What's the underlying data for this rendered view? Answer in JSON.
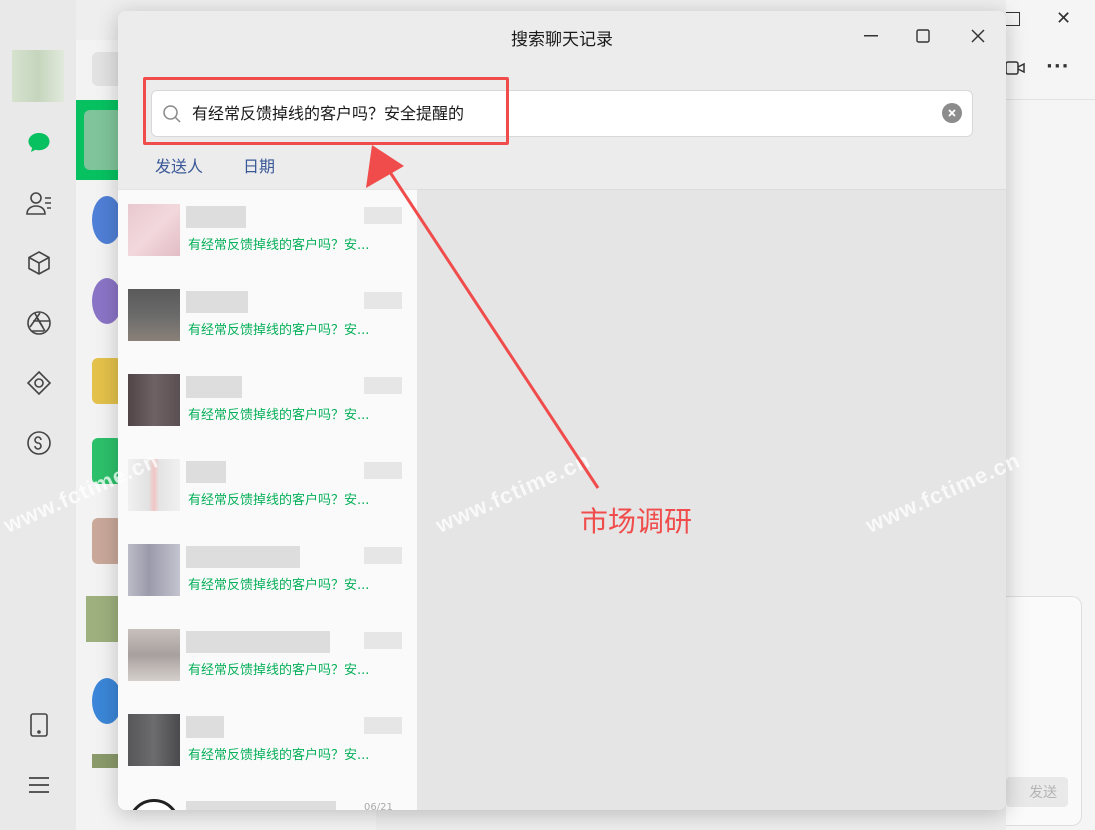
{
  "dialog": {
    "title": "搜索聊天记录",
    "search_value": "有经常反馈掉线的客户吗？安全提醒的",
    "filters": [
      "发送人",
      "日期"
    ]
  },
  "results": [
    {
      "snippet": "有经常反馈掉线的客户吗？安..."
    },
    {
      "snippet": "有经常反馈掉线的客户吗？安..."
    },
    {
      "snippet": "有经常反馈掉线的客户吗？安..."
    },
    {
      "snippet": "有经常反馈掉线的客户吗？安..."
    },
    {
      "snippet": "有经常反馈掉线的客户吗？安..."
    },
    {
      "snippet": "有经常反馈掉线的客户吗？安..."
    },
    {
      "snippet": "有经常反馈掉线的客户吗？安..."
    },
    {
      "snippet": "06/21"
    }
  ],
  "background": {
    "send_label": "发送"
  },
  "annotation": {
    "label": "市场调研",
    "color": "#f04c4c"
  },
  "watermark": "www.fctime.cn",
  "colors": {
    "accent": "#07c160",
    "snippet": "#07b05a",
    "filter_link": "#3b5998"
  }
}
